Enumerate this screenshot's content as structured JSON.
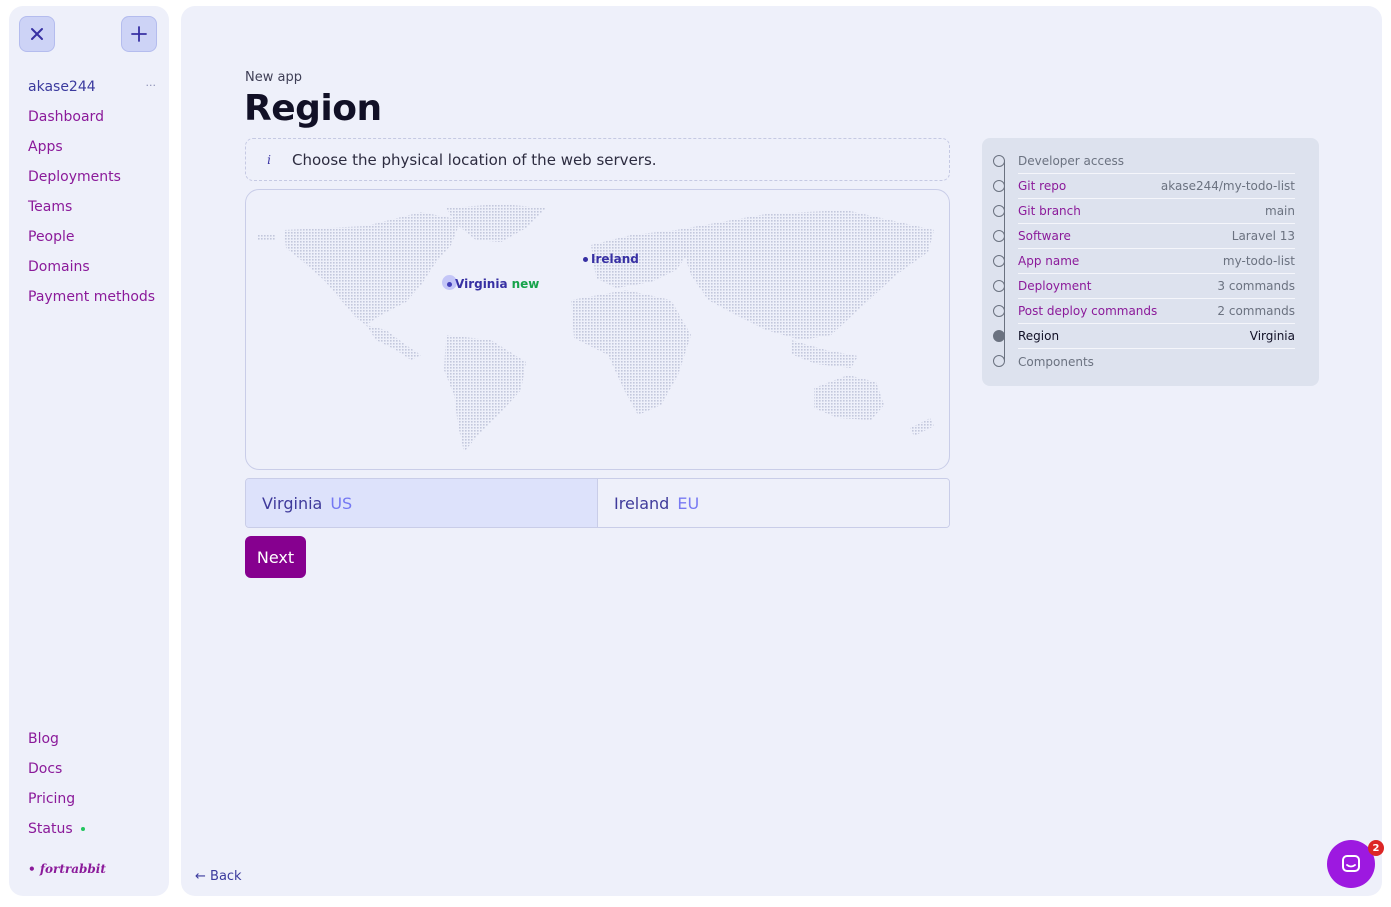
{
  "sidebar": {
    "user": "akase244",
    "user_menu": "···",
    "items": [
      "Dashboard",
      "Apps",
      "Deployments",
      "Teams",
      "People",
      "Domains",
      "Payment methods"
    ],
    "bottom_items": [
      "Blog",
      "Docs",
      "Pricing",
      "Status"
    ],
    "brand": "• fortrabbit"
  },
  "page": {
    "breadcrumb": "New app",
    "title": "Region",
    "info_text": "Choose the physical location of the web servers."
  },
  "map": {
    "pins": [
      {
        "label": "Virginia",
        "badge": "new"
      },
      {
        "label": "Ireland",
        "badge": ""
      }
    ]
  },
  "regions": [
    {
      "name": "Virginia",
      "code": "US",
      "selected": true
    },
    {
      "name": "Ireland",
      "code": "EU",
      "selected": false
    }
  ],
  "actions": {
    "next": "Next",
    "back": "← Back"
  },
  "steps": [
    {
      "label": "Developer access",
      "value": "",
      "state": "muted"
    },
    {
      "label": "Git repo",
      "value": "akase244/my-todo-list",
      "state": "done"
    },
    {
      "label": "Git branch",
      "value": "main",
      "state": "done"
    },
    {
      "label": "Software",
      "value": "Laravel 13",
      "state": "done"
    },
    {
      "label": "App name",
      "value": "my-todo-list",
      "state": "done"
    },
    {
      "label": "Deployment",
      "value": "3 commands",
      "state": "done"
    },
    {
      "label": "Post deploy commands",
      "value": "2 commands",
      "state": "done"
    },
    {
      "label": "Region",
      "value": "Virginia",
      "state": "current"
    },
    {
      "label": "Components",
      "value": "",
      "state": "muted"
    }
  ],
  "chat": {
    "badge_count": "2"
  },
  "colors": {
    "accent": "#86008f",
    "link": "#8b1a9a",
    "indigo": "#3730a3",
    "status_green": "#22c55e"
  }
}
